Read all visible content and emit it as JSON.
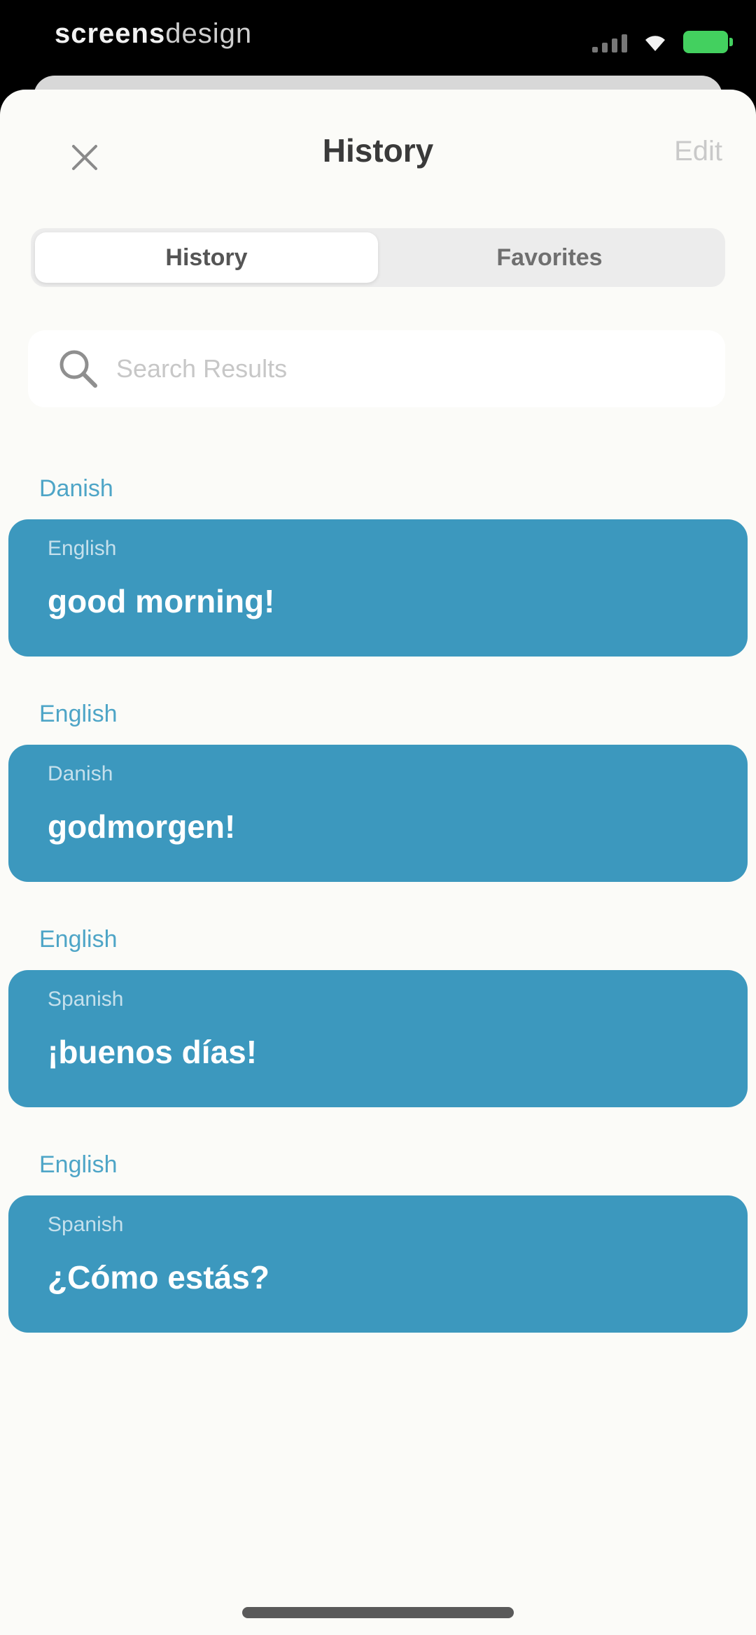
{
  "status_bar": {
    "brand_strong": "screens",
    "brand_light": "design"
  },
  "nav": {
    "title": "History",
    "edit_label": "Edit"
  },
  "tabs": [
    {
      "label": "History",
      "active": true
    },
    {
      "label": "Favorites",
      "active": false
    }
  ],
  "search": {
    "placeholder": "Search Results",
    "value": ""
  },
  "history": [
    {
      "source_language": "Danish",
      "target_language": "English",
      "text": "good morning!"
    },
    {
      "source_language": "English",
      "target_language": "Danish",
      "text": "godmorgen!"
    },
    {
      "source_language": "English",
      "target_language": "Spanish",
      "text": "¡buenos días!"
    },
    {
      "source_language": "English",
      "target_language": "Spanish",
      "text": "¿Cómo estás?"
    }
  ],
  "colors": {
    "card": "#3c98be",
    "language_label": "#4ea5c7",
    "sheet_background": "#fbfbf8",
    "battery": "#43d05f"
  },
  "icons": {
    "close": "close-icon",
    "search": "search-icon",
    "signal": "cellular-signal-icon",
    "wifi": "wifi-icon",
    "battery": "battery-icon"
  }
}
